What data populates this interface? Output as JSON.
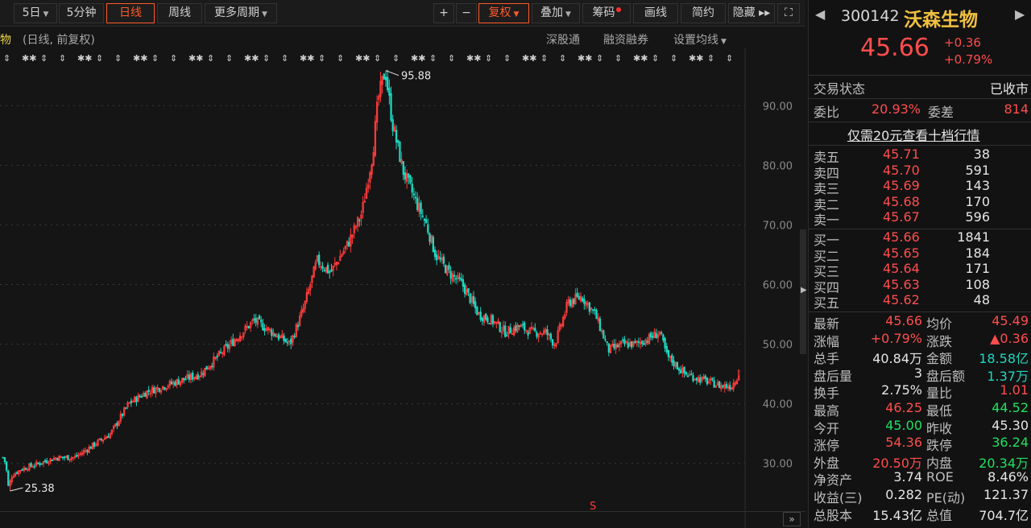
{
  "toolbar": {
    "items": [
      {
        "label": "5日",
        "dropdown": true
      },
      {
        "label": "5分钟",
        "dropdown": false
      },
      {
        "label": "日线",
        "dropdown": false,
        "active": true
      },
      {
        "label": "周线",
        "dropdown": false
      },
      {
        "label": "更多周期",
        "dropdown": true
      }
    ],
    "right_items": [
      {
        "label": "+"
      },
      {
        "label": "−"
      },
      {
        "label": "复权",
        "dropdown": true,
        "active": true
      },
      {
        "label": "叠加",
        "dropdown": true
      },
      {
        "label": "筹码",
        "badge": true
      },
      {
        "label": "画线"
      },
      {
        "label": "简约"
      },
      {
        "label": "隐藏 ▸▸"
      },
      {
        "label": "⛶"
      }
    ]
  },
  "chart_header": {
    "name_fragment": "物",
    "mode": "(日线, 前复权)",
    "links": [
      "深股通",
      "融资融券",
      "设置均线"
    ]
  },
  "chart_data": {
    "type": "candlestick",
    "ylim": [
      22,
      98
    ],
    "y_ticks": [
      "90.00",
      "80.00",
      "70.00",
      "60.00",
      "50.00",
      "40.00",
      "30.00"
    ],
    "y_tick_values": [
      90,
      80,
      70,
      60,
      50,
      40,
      30
    ],
    "colors": {
      "up": "#ff3b3b",
      "down": "#1fd7c0",
      "grid": "#3a3a3a",
      "axis_text": "#8a8a8a"
    },
    "annotations": [
      {
        "label": "95.88",
        "value": 95.88,
        "kind": "high"
      },
      {
        "label": "25.38",
        "value": 25.38,
        "kind": "low"
      }
    ],
    "markers_row": "info",
    "keyframes": [
      [
        0,
        31
      ],
      [
        3,
        30
      ],
      [
        6,
        26
      ],
      [
        10,
        28
      ],
      [
        20,
        29
      ],
      [
        40,
        30
      ],
      [
        60,
        31
      ],
      [
        80,
        31
      ],
      [
        100,
        33
      ],
      [
        120,
        35
      ],
      [
        140,
        40
      ],
      [
        160,
        42
      ],
      [
        180,
        43
      ],
      [
        200,
        44
      ],
      [
        220,
        45
      ],
      [
        240,
        48
      ],
      [
        260,
        51
      ],
      [
        280,
        54
      ],
      [
        300,
        52
      ],
      [
        320,
        50
      ],
      [
        335,
        56
      ],
      [
        350,
        64
      ],
      [
        365,
        62
      ],
      [
        385,
        67
      ],
      [
        400,
        72
      ],
      [
        412,
        82
      ],
      [
        418,
        91
      ],
      [
        426,
        96
      ],
      [
        434,
        87
      ],
      [
        446,
        79
      ],
      [
        460,
        74
      ],
      [
        472,
        70
      ],
      [
        482,
        65
      ],
      [
        497,
        62
      ],
      [
        512,
        60
      ],
      [
        530,
        55
      ],
      [
        545,
        54
      ],
      [
        560,
        52
      ],
      [
        575,
        53
      ],
      [
        590,
        52
      ],
      [
        605,
        52
      ],
      [
        615,
        50
      ],
      [
        630,
        57
      ],
      [
        645,
        58
      ],
      [
        660,
        55
      ],
      [
        675,
        49
      ],
      [
        690,
        50
      ],
      [
        705,
        50
      ],
      [
        720,
        51
      ],
      [
        732,
        52
      ],
      [
        740,
        48
      ],
      [
        760,
        45
      ],
      [
        780,
        44
      ],
      [
        800,
        43
      ],
      [
        812,
        43
      ],
      [
        820,
        45
      ]
    ],
    "final_close": 45.66
  },
  "quote": {
    "code": "300142",
    "name": "沃森生物",
    "price": "45.66",
    "change": "+0.36",
    "change_pct": "+0.79%",
    "trade_status_label": "交易状态",
    "trade_status": "已收市",
    "weibi_label": "委比",
    "weibi": "20.93%",
    "weicha_label": "委差",
    "weicha": "814",
    "promo": "仅需20元查看十档行情",
    "asks": [
      {
        "label": "卖五",
        "price": "45.71",
        "vol": "38"
      },
      {
        "label": "卖四",
        "price": "45.70",
        "vol": "591"
      },
      {
        "label": "卖三",
        "price": "45.69",
        "vol": "143"
      },
      {
        "label": "卖二",
        "price": "45.68",
        "vol": "170"
      },
      {
        "label": "卖一",
        "price": "45.67",
        "vol": "596"
      }
    ],
    "bids": [
      {
        "label": "买一",
        "price": "45.66",
        "vol": "1841"
      },
      {
        "label": "买二",
        "price": "45.65",
        "vol": "184"
      },
      {
        "label": "买三",
        "price": "45.64",
        "vol": "171"
      },
      {
        "label": "买四",
        "price": "45.63",
        "vol": "108"
      },
      {
        "label": "买五",
        "price": "45.62",
        "vol": "48"
      }
    ],
    "stats": [
      {
        "l1": "最新",
        "v1": "45.66",
        "c1": "red",
        "l2": "均价",
        "v2": "45.49",
        "c2": "red"
      },
      {
        "l1": "涨幅",
        "v1": "+0.79%",
        "c1": "red",
        "l2": "涨跌",
        "v2": "▲0.36",
        "c2": "red"
      },
      {
        "l1": "总手",
        "v1": "40.84万",
        "c1": "white",
        "l2": "金额",
        "v2": "18.58亿",
        "c2": "green"
      },
      {
        "l1": "盘后量",
        "v1": "3",
        "c1": "white",
        "l2": "盘后额",
        "v2": "1.37万",
        "c2": "green"
      },
      {
        "l1": "换手",
        "v1": "2.75%",
        "c1": "white",
        "l2": "量比",
        "v2": "1.01",
        "c2": "red"
      },
      {
        "l1": "最高",
        "v1": "46.25",
        "c1": "red",
        "l2": "最低",
        "v2": "44.52",
        "c2": "grn"
      },
      {
        "l1": "今开",
        "v1": "45.00",
        "c1": "grn",
        "l2": "昨收",
        "v2": "45.30",
        "c2": "white"
      },
      {
        "l1": "涨停",
        "v1": "54.36",
        "c1": "red",
        "l2": "跌停",
        "v2": "36.24",
        "c2": "grn"
      },
      {
        "l1": "外盘",
        "v1": "20.50万",
        "c1": "red",
        "l2": "内盘",
        "v2": "20.34万",
        "c2": "grn"
      },
      {
        "l1": "净资产",
        "v1": "3.74",
        "c1": "white",
        "l2": "ROE",
        "v2": "8.46%",
        "c2": "white"
      },
      {
        "l1": "收益(三)",
        "v1": "0.282",
        "c1": "white",
        "l2": "PE(动)",
        "v2": "121.37",
        "c2": "white"
      },
      {
        "l1": "总股本",
        "v1": "15.43亿",
        "c1": "white",
        "l2": "总值",
        "v2": "704.7亿",
        "c2": "white"
      }
    ]
  }
}
